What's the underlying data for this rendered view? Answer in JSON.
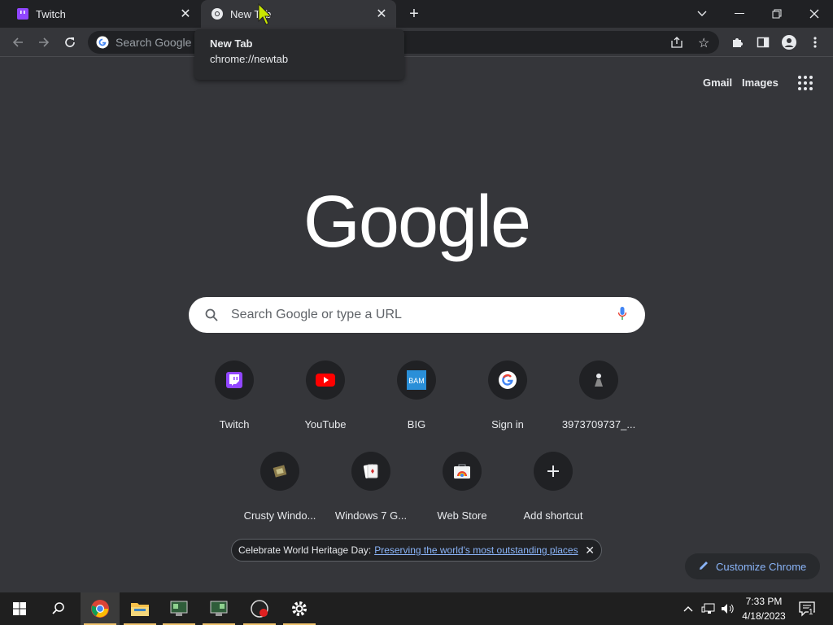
{
  "tabs": [
    {
      "title": "Twitch",
      "icon": "twitch-favicon"
    },
    {
      "title": "New Tab",
      "icon": "chrome-favicon"
    }
  ],
  "tooltip": {
    "title": "New Tab",
    "url": "chrome://newtab"
  },
  "omnibox": {
    "placeholder": "Search Google or type a URL"
  },
  "header_links": {
    "gmail": "Gmail",
    "images": "Images"
  },
  "logo_text": "Google",
  "search": {
    "placeholder": "Search Google or type a URL"
  },
  "shortcuts": [
    {
      "label": "Twitch",
      "icon": "twitch-icon"
    },
    {
      "label": "YouTube",
      "icon": "youtube-icon"
    },
    {
      "label": "BIG",
      "icon": "bam-icon"
    },
    {
      "label": "Sign in",
      "icon": "google-g-icon"
    },
    {
      "label": "3973709737_...",
      "icon": "figure-icon"
    },
    {
      "label": "Crusty Windo...",
      "icon": "crusty-icon"
    },
    {
      "label": "Windows 7 G...",
      "icon": "cards-icon"
    },
    {
      "label": "Web Store",
      "icon": "webstore-icon"
    },
    {
      "label": "Add shortcut",
      "icon": "plus-icon"
    }
  ],
  "banner": {
    "lead": "Celebrate World Heritage Day:",
    "link": "Preserving the world's most outstanding places"
  },
  "customize_label": "Customize Chrome",
  "clock": {
    "time": "7:33 PM",
    "date": "4/18/2023"
  },
  "notifications_count": "1",
  "colors": {
    "page_bg": "#35363a",
    "tabstrip_bg": "#202124",
    "link_blue": "#8ab4f8",
    "taskbar_bg": "#1f1f1f"
  }
}
